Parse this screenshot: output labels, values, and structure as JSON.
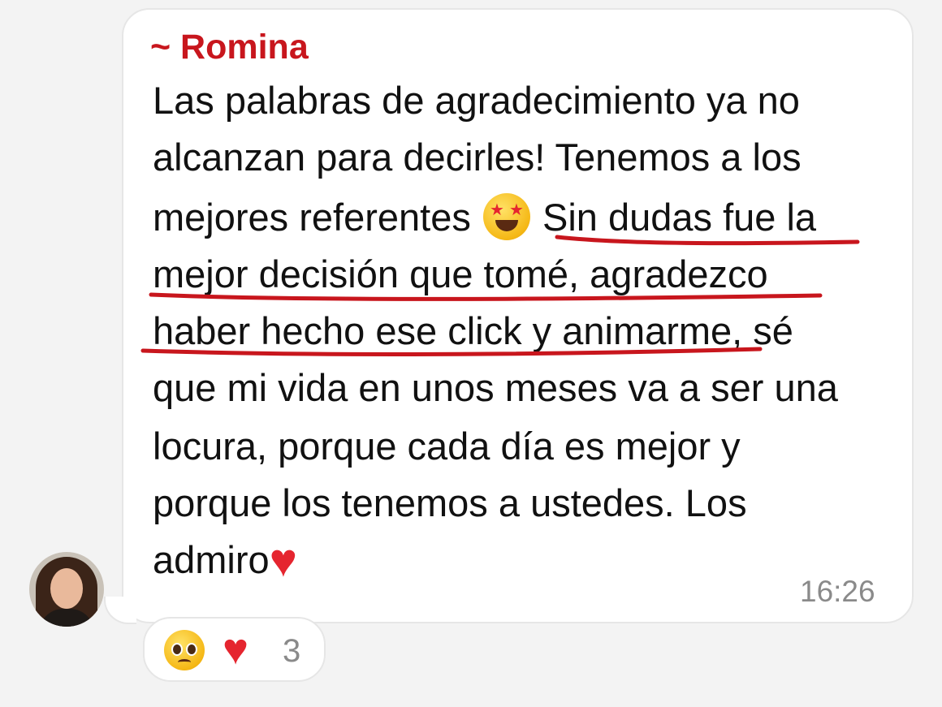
{
  "message": {
    "sender": "~ Romina",
    "lines": [
      "Las palabras de agradecimiento ya no",
      "alcanzan para decirles! Tenemos a los",
      "mejores referentes",
      "Sin dudas fue la",
      "mejor decisión que tomé, agradezco",
      "haber hecho ese click y animarme, sé",
      "que mi vida en unos meses va a ser una",
      "locura, porque cada día es mejor y",
      "porque los tenemos a ustedes. Los",
      "admiro"
    ],
    "inline_emoji": "star-struck-emoji",
    "trailing_emoji": "red-heart-emoji",
    "time": "16:26"
  },
  "reactions": {
    "items": [
      "pleading-face-emoji",
      "red-heart-emoji"
    ],
    "count": "3"
  },
  "colors": {
    "sender": "#c8161d",
    "underline": "#c8161d",
    "text": "#111111",
    "muted": "#8a8a8a",
    "background": "#f3f3f3"
  }
}
